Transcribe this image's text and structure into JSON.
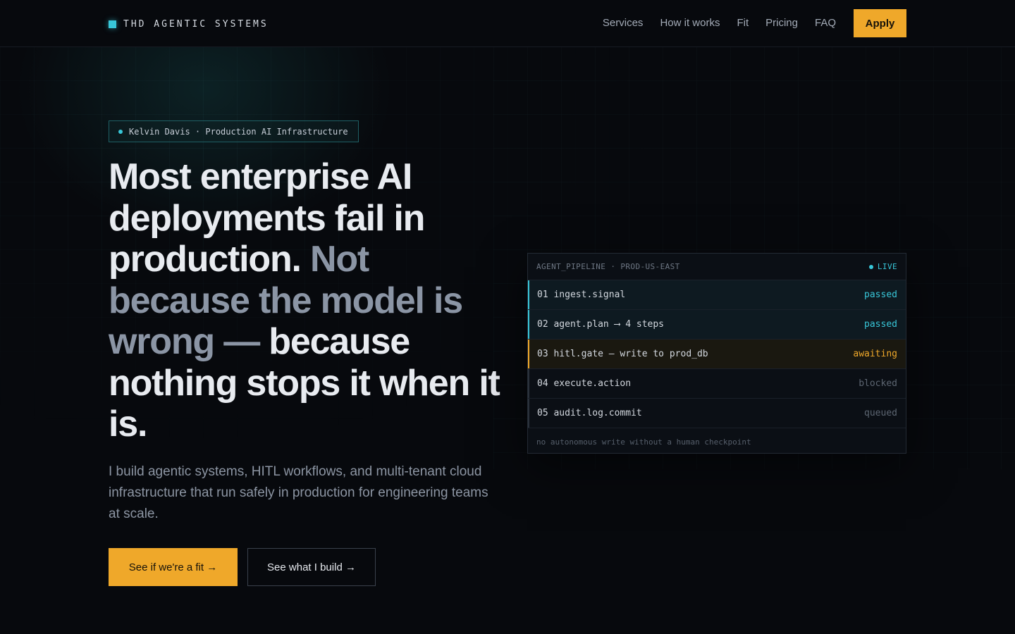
{
  "nav": {
    "brand": "THD AGENTIC SYSTEMS",
    "links": [
      "Services",
      "How it works",
      "Fit",
      "Pricing",
      "FAQ"
    ],
    "apply_label": "Apply"
  },
  "hero": {
    "badge": "Kelvin Davis · Production AI Infrastructure",
    "headline_part1": "Most enterprise AI deployments fail in production. ",
    "headline_part2": "Not because the model is wrong — ",
    "headline_part3": "because nothing stops it when it is.",
    "subtext": "I build agentic systems, HITL workflows, and multi-tenant cloud infrastructure that run safely in production for engineering teams at scale.",
    "cta_primary": "See if we're a fit →",
    "cta_secondary": "See what I build →"
  },
  "pipeline": {
    "title": "AGENT_PIPELINE · PROD-US-EAST",
    "live_label": "LIVE",
    "steps": [
      {
        "label": "01 ingest.signal",
        "status": "passed"
      },
      {
        "label": "02 agent.plan ⟶ 4 steps",
        "status": "passed"
      },
      {
        "label": "03 hitl.gate — write to prod_db",
        "status": "awaiting"
      },
      {
        "label": "04 execute.action",
        "status": "blocked"
      },
      {
        "label": "05 audit.log.commit",
        "status": "queued"
      }
    ],
    "footer": "no autonomous write without a human checkpoint"
  },
  "colors": {
    "background": "#07090d",
    "accent_cyan": "#38c6d8",
    "accent_amber": "#efa82a",
    "muted_text": "#8b95a5"
  }
}
